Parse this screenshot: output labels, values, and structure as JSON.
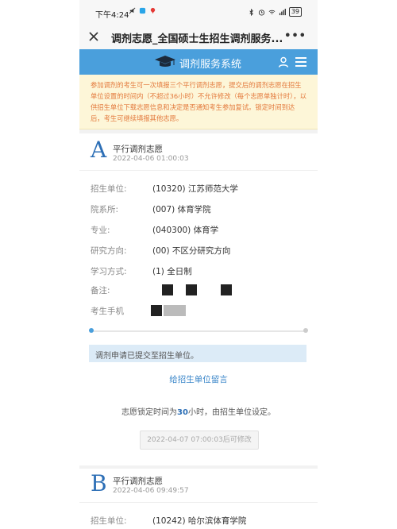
{
  "status_bar": {
    "time": "下午4:24",
    "battery": "39"
  },
  "nav": {
    "title": "调剂志愿_全国硕士生招生调剂服务...",
    "more": "•••"
  },
  "app": {
    "name": "调剂服务系统"
  },
  "notice": "参加调剂的考生可一次填报三个平行调剂志愿，提交后的调剂志愿在招生单位设置的时间内（不超过36小时）不允许修改（每个志愿单独计时），以供招生单位下载志愿信息和决定是否通知考生参加复试。锁定时间到达后，考生可继续填报其他志愿。",
  "card_a": {
    "letter": "A",
    "title": "平行调剂志愿",
    "date": "2022-04-06 01:00:03",
    "rows": [
      {
        "label": "招生单位:",
        "value": "(10320) 江苏师范大学"
      },
      {
        "label": "院系所:",
        "value": "(007) 体育学院"
      },
      {
        "label": "专业:",
        "value": "(040300) 体育学"
      },
      {
        "label": "研究方向:",
        "value": "(00) 不区分研究方向"
      },
      {
        "label": "学习方式:",
        "value": "(1) 全日制"
      },
      {
        "label": "备注:",
        "value": ""
      },
      {
        "label": "考生手机",
        "value": ""
      }
    ],
    "status_text": "调剂申请已提交至招生单位。",
    "message_link": "给招生单位留言",
    "lock_prefix": "志愿锁定时间为",
    "lock_hours": "30",
    "lock_suffix": "小时，由招生单位设定。",
    "modify_button": "2022-04-07 07:00:03后可修改"
  },
  "card_b": {
    "letter": "B",
    "title": "平行调剂志愿",
    "date": "2022-04-06 09:49:57",
    "rows": [
      {
        "label": "招生单位:",
        "value": "(10242) 哈尔滨体育学院"
      }
    ]
  },
  "colors": {
    "accent": "#4a9fdc",
    "notice_text": "#e3793c",
    "letter": "#2d6fb6"
  }
}
